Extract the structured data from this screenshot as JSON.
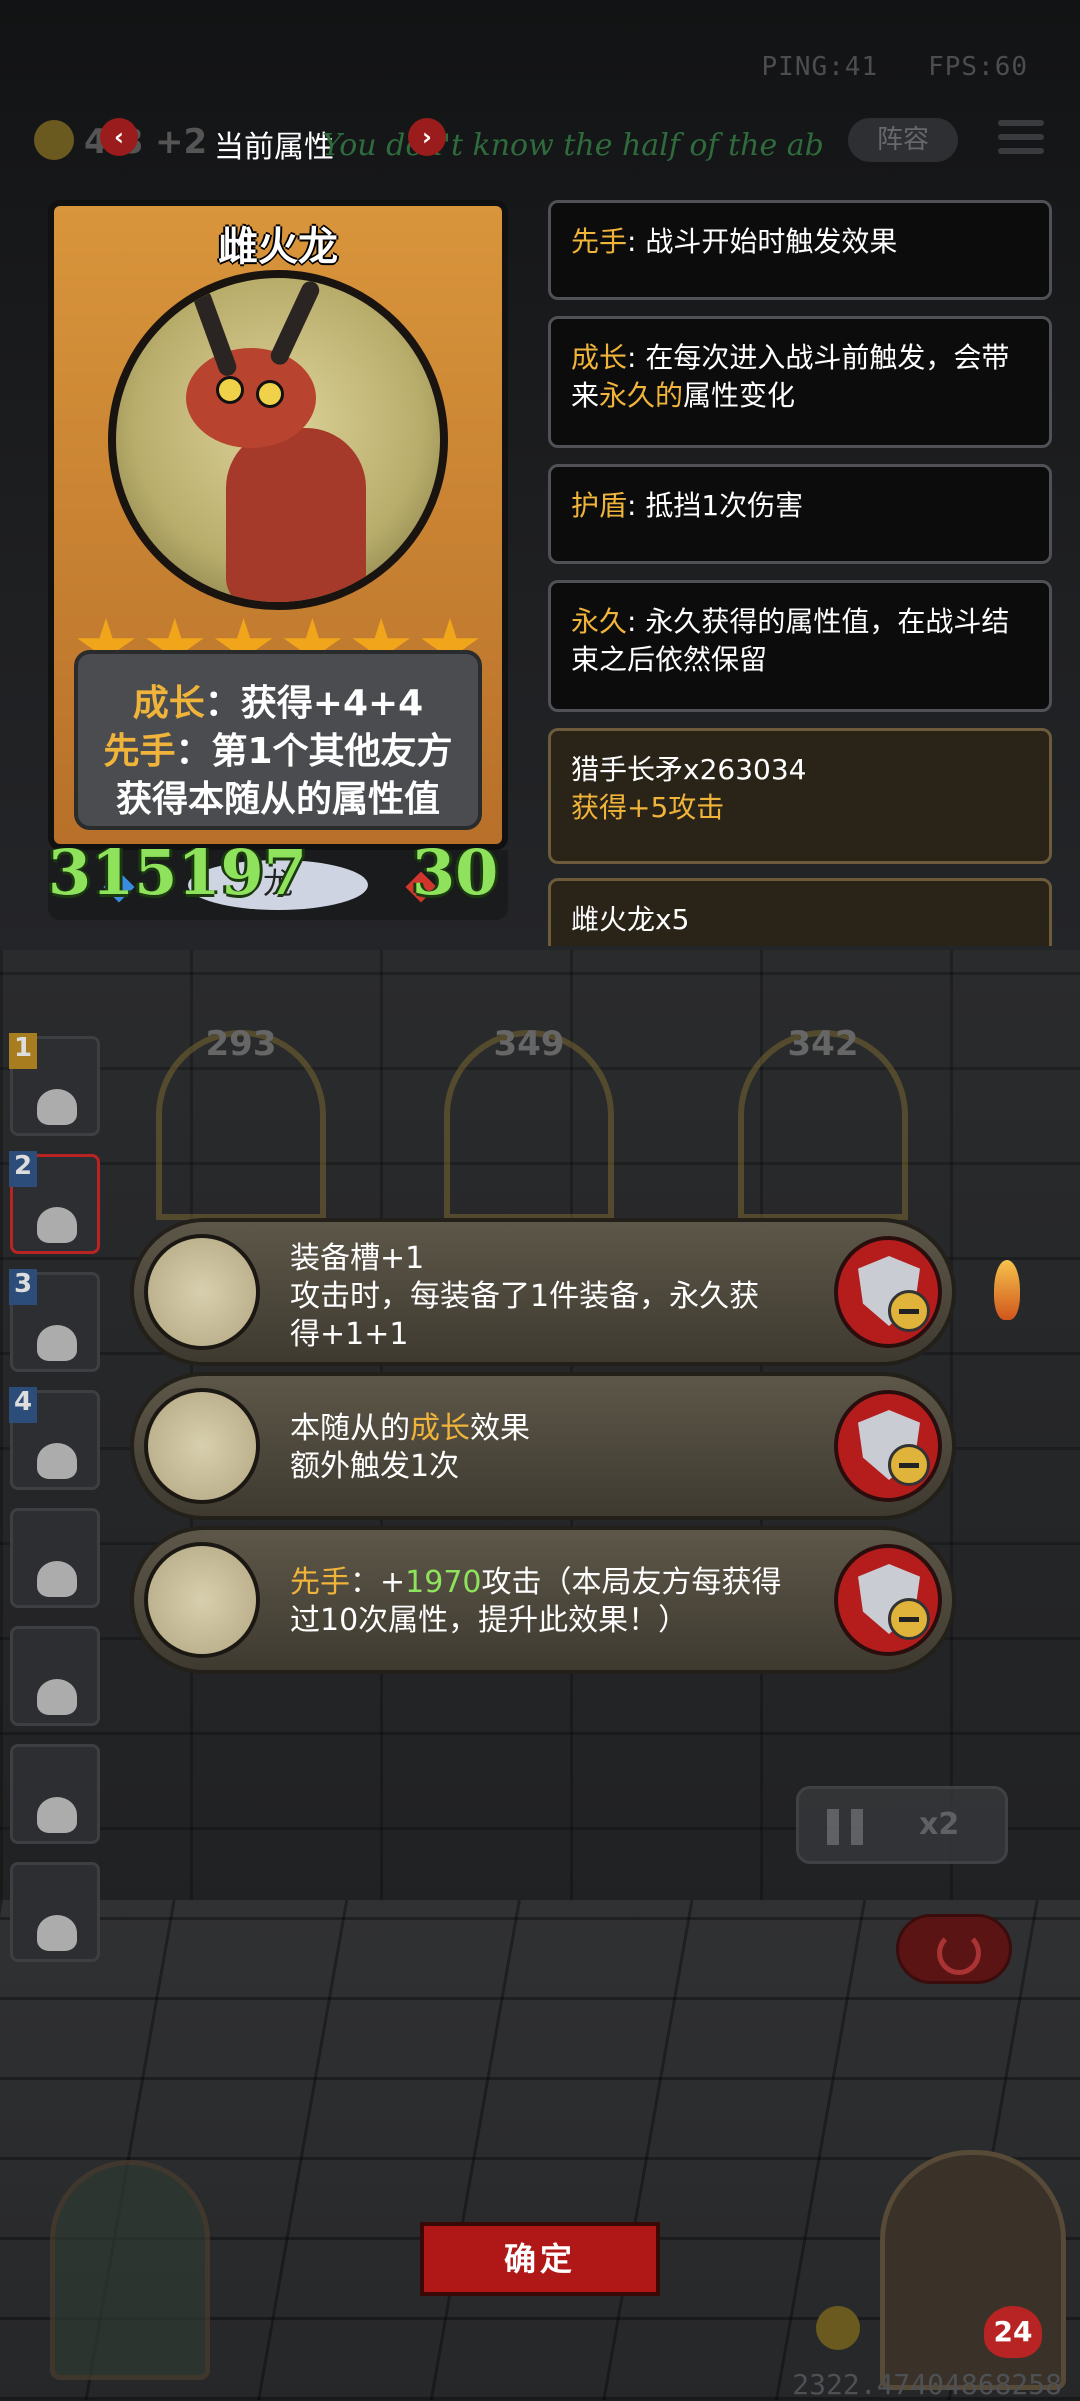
{
  "hud": {
    "ping": "PING:41",
    "fps": "FPS:60",
    "coins": "4 8 +2",
    "panel_title": "当前属性",
    "marquee": "You don't know the half of the ab",
    "formation_label": "阵容",
    "prev_icon": "chevron-left-icon",
    "next_icon": "chevron-right-icon"
  },
  "card": {
    "name": "雌火龙",
    "stars": 6,
    "desc_lines": [
      {
        "kw": "成长",
        "text": "：获得+4+4"
      },
      {
        "kw": "先手",
        "text": "：第1个其他友方"
      },
      {
        "kw": "",
        "text": "获得本随从的属性值"
      }
    ],
    "attack": "315197",
    "health": "30",
    "tribe": "龙"
  },
  "info_boxes": [
    {
      "kw": "先手",
      "text": ": 战斗开始时触发效果",
      "style": "dark"
    },
    {
      "kw": "成长",
      "text": ": 在每次进入战斗前触发，会带来",
      "kw2": "永久的",
      "text2": "属性变化",
      "style": "dark"
    },
    {
      "kw": "护盾",
      "text": ": 抵挡1次伤害",
      "style": "dark"
    },
    {
      "kw": "永久",
      "text": ": 永久获得的属性值，在战斗结束之后依然保留",
      "style": "dark"
    },
    {
      "title": "猎手长矛x263034",
      "sub": "获得+5攻击",
      "style": "brown"
    },
    {
      "title": "雌火龙x5",
      "style": "brown"
    }
  ],
  "arches": [
    "293",
    "349",
    "342"
  ],
  "team_slots": [
    "1",
    "2",
    "3",
    "4",
    "",
    "",
    "",
    ""
  ],
  "equipment": [
    {
      "name": "horseshoe-icon",
      "line1": "装备槽+1",
      "line2": "攻击时，每装备了1件装备，永久获",
      "line3": "得+1+1"
    },
    {
      "name": "pocket-watch-gauntlet-icon",
      "line1_pre": "本随从的",
      "line1_kw": "成长",
      "line1_post": "效果",
      "line2": "额外触发1次"
    },
    {
      "name": "spear-icon",
      "line1_kw": "先手",
      "line1_mid": "：+",
      "line1_green": "1970",
      "line1_post": "攻击（本局友方每获得",
      "line2": "过10次属性，提升此效果！）"
    }
  ],
  "controls": {
    "speed": "x2"
  },
  "confirm_label": "确定",
  "hero_health": "24",
  "bottom_number": "2322.47404868258",
  "colors": {
    "keyword": "#f0b43a",
    "stat_green": "#8ee25c",
    "accent_red": "#b01818"
  }
}
